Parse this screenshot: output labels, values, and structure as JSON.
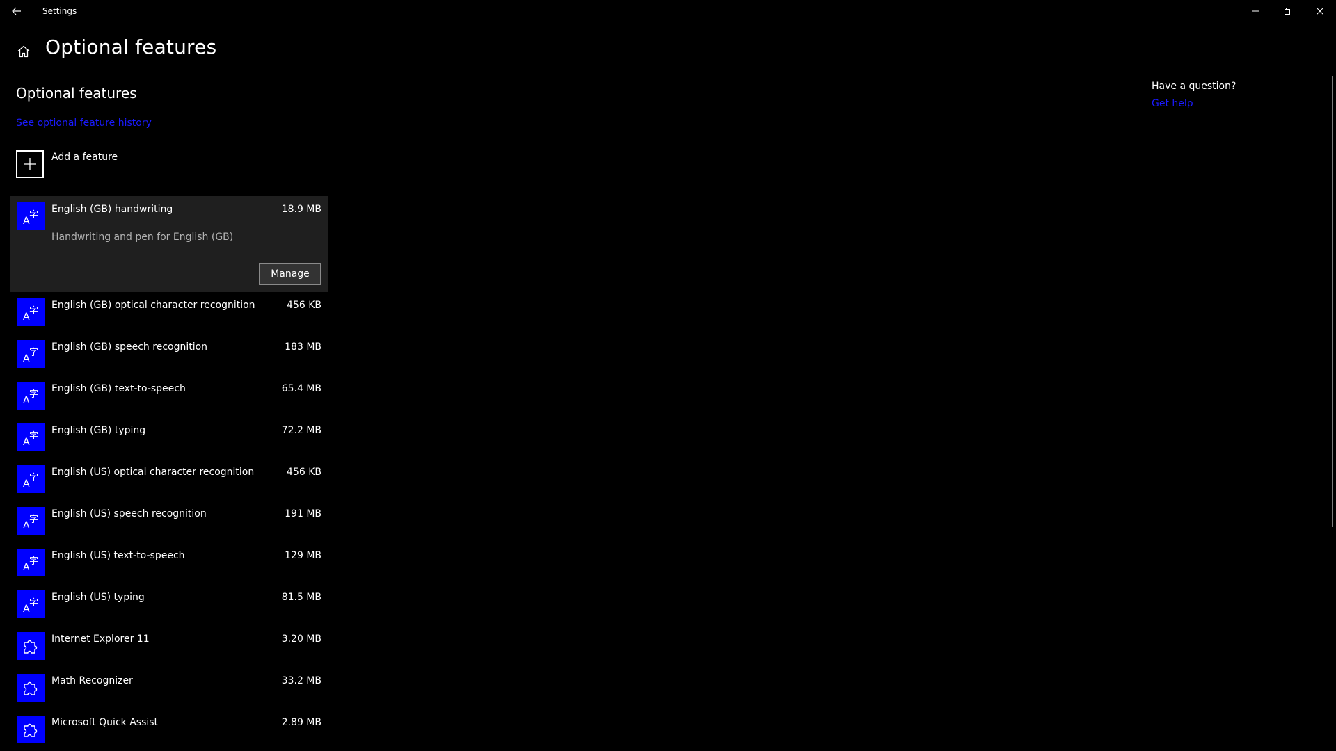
{
  "titlebar": {
    "app_title": "Settings",
    "back_icon": "back-arrow-icon",
    "controls": [
      "minimize-icon",
      "restore-icon",
      "close-icon"
    ]
  },
  "header": {
    "title": "Optional features",
    "home_icon": "home-icon"
  },
  "section": {
    "title": "Optional features",
    "history_link": "See optional feature history",
    "add_feature_label": "Add a feature"
  },
  "features": [
    {
      "name": "English (GB) handwriting",
      "size": "18.9 MB",
      "icon": "language-icon",
      "description": "Handwriting and pen for English (GB)",
      "manage_label": "Manage",
      "expanded": true
    },
    {
      "name": "English (GB) optical character recognition",
      "size": "456 KB",
      "icon": "language-icon"
    },
    {
      "name": "English (GB) speech recognition",
      "size": "183 MB",
      "icon": "language-icon"
    },
    {
      "name": "English (GB) text-to-speech",
      "size": "65.4 MB",
      "icon": "language-icon"
    },
    {
      "name": "English (GB) typing",
      "size": "72.2 MB",
      "icon": "language-icon"
    },
    {
      "name": "English (US) optical character recognition",
      "size": "456 KB",
      "icon": "language-icon"
    },
    {
      "name": "English (US) speech recognition",
      "size": "191 MB",
      "icon": "language-icon"
    },
    {
      "name": "English (US) text-to-speech",
      "size": "129 MB",
      "icon": "language-icon"
    },
    {
      "name": "English (US) typing",
      "size": "81.5 MB",
      "icon": "language-icon"
    },
    {
      "name": "Internet Explorer 11",
      "size": "3.20 MB",
      "icon": "puzzle-piece-icon"
    },
    {
      "name": "Math Recognizer",
      "size": "33.2 MB",
      "icon": "puzzle-piece-icon"
    },
    {
      "name": "Microsoft Quick Assist",
      "size": "2.89 MB",
      "icon": "puzzle-piece-icon"
    }
  ],
  "help": {
    "title": "Have a question?",
    "link": "Get help"
  },
  "colors": {
    "background": "#000000",
    "accent": "#0000ff",
    "link": "#1a1aff",
    "expanded_item_bg": "#1f1f1f"
  }
}
